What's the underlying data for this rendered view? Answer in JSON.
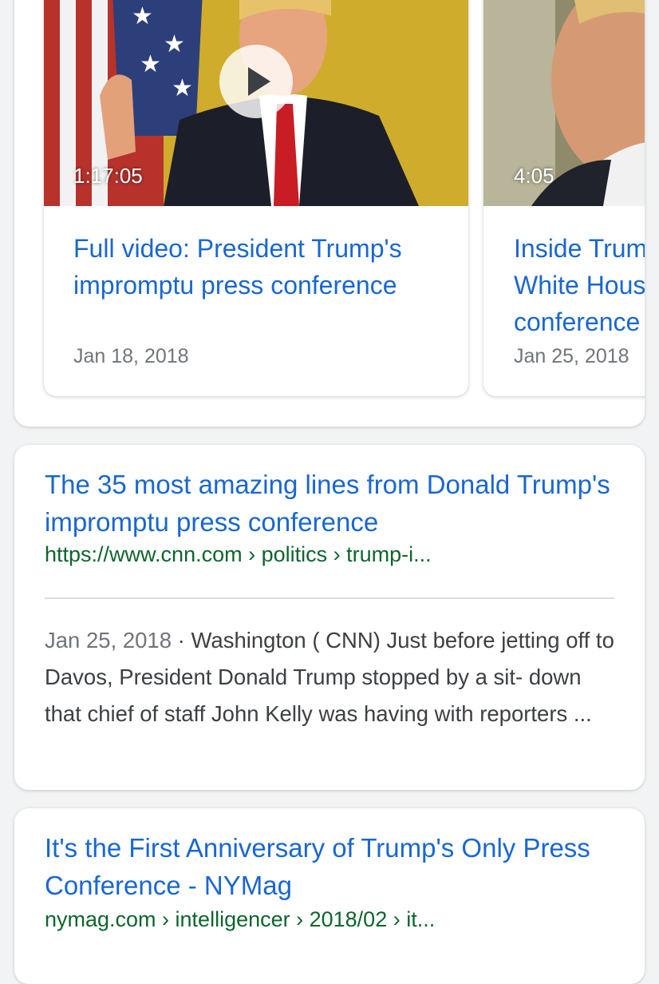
{
  "videos": [
    {
      "duration": "1:17:05",
      "title": "Full video: President Trump's impromptu press conference",
      "date": "Jan 18, 2018",
      "play_icon": "play-icon"
    },
    {
      "duration": "4:05",
      "title": "Inside Trum\nWhite Hous\nconference",
      "date": "Jan 25, 2018"
    }
  ],
  "results": [
    {
      "title": "The 35 most amazing lines from Donald Trump's impromptu press conference",
      "url": "https://www.cnn.com › politics › trump-i...",
      "date": "Jan 25, 2018",
      "separator": " · ",
      "snippet": "Washington ( CNN) Just before jetting off to Davos, President Donald Trump stopped by a sit- down that chief of staff John Kelly was having with reporters ..."
    },
    {
      "title": "It's the First Anniversary of Trump's Only Press Conference - NYMag",
      "url": "nymag.com › intelligencer › 2018/02 › it..."
    }
  ],
  "colors": {
    "link": "#1967d2",
    "url": "#0d652d",
    "meta": "#70757a",
    "background": "#f1f3f4"
  }
}
